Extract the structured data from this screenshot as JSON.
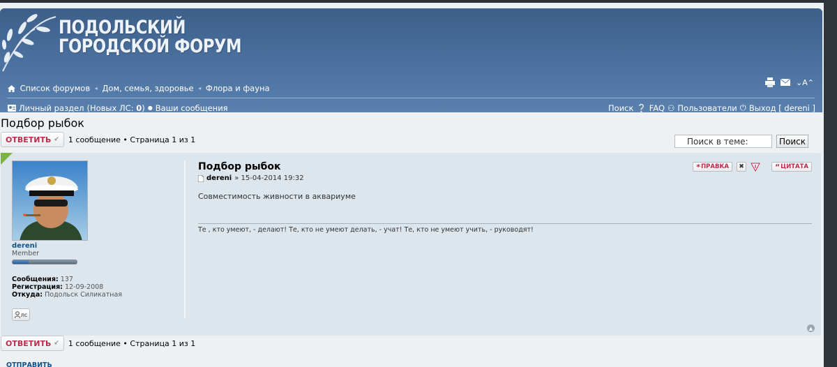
{
  "header": {
    "logo_line1": "ПОДОЛЬСКИЙ",
    "logo_line2": "ГОРОДСКОЙ ФОРУМ",
    "breadcrumbs": [
      "Список форумов",
      "Дом, семья, здоровье",
      "Флора и фауна"
    ],
    "font_size_label": "⌄A⌃"
  },
  "navbar": {
    "personal_label": "Личный раздел",
    "new_pm_prefix": "(Новых ЛС: ",
    "new_pm_count": "0",
    "new_pm_suffix": ")",
    "your_posts": "Ваши сообщения",
    "search": "Поиск",
    "faq": "FAQ",
    "members": "Пользователи",
    "logout": "Выход [ dereni ]"
  },
  "topic": {
    "title": "Подбор рыбок",
    "reply_label": "ОТВЕТИТЬ",
    "pagination": "1 сообщение • Страница 1 из 1",
    "search_placeholder": "Поиск в теме:",
    "search_button": "Поиск"
  },
  "post": {
    "author": "dereni",
    "rank": "Member",
    "rank_progress": 0.25,
    "posts_label": "Сообщения:",
    "posts_value": "137",
    "reg_label": "Регистрация:",
    "reg_value": "12-09-2008",
    "from_label": "Откуда:",
    "from_value": "Подольск Силикатная",
    "pm_label": "лс",
    "title": "Подбор рыбок",
    "meta_author": "dereni",
    "meta_date": "» 15-04-2014 19:32",
    "text": "Совместимость живности в аквариуме",
    "signature": "Те , кто умеют, - делают! Те, кто не умеют делать, - учат! Те, кто не умеют учить, - руководят!",
    "edit_label": "ПРАВКА",
    "quote_label": "ЦИТАТА"
  },
  "footer": {
    "send_label": "ОТПРАВИТЬ"
  },
  "colors": {
    "header_blue": "#4c72a1",
    "reply_red": "#bc2a4d",
    "link_blue": "#105289",
    "post_bg": "#dde6ec",
    "corner_green": "#7cb340"
  }
}
